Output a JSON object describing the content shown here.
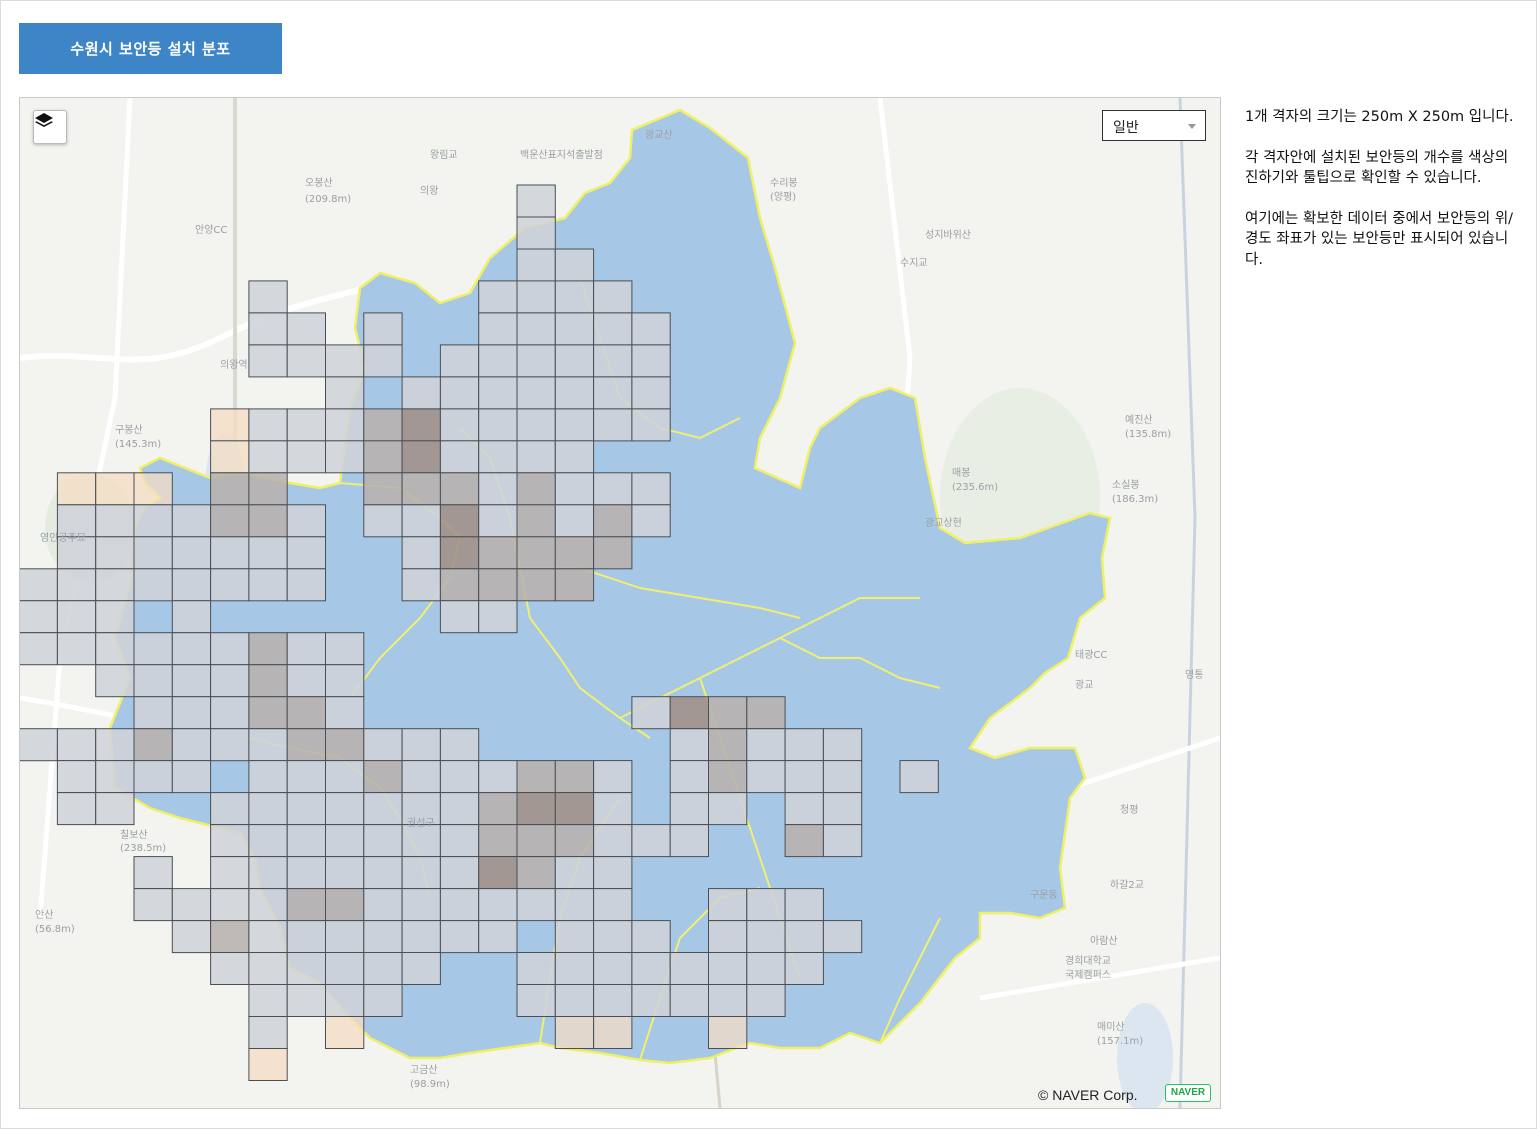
{
  "header": {
    "title": "수원시  보안등 설치 분포"
  },
  "map": {
    "map_type_selected": "일반",
    "copyright": "© NAVER Corp.",
    "logo_text": "NAVER",
    "grid_cell_size": "250m X 250m",
    "place_labels": [
      "오봉산",
      "(209.8m)",
      "안양CC",
      "의왕",
      "의왕역",
      "구봉산",
      "(145.3m)",
      "영안공주묘",
      "칠보산",
      "(238.5m)",
      "안산",
      "(56.8m)",
      "왕림교",
      "백운산표지석출발점",
      "광교산",
      "수리봉",
      "(양평)",
      "성지바위산",
      "수지교",
      "예진산",
      "(135.8m)",
      "소실봉",
      "(186.3m)",
      "매봉",
      "(235.6m)",
      "광교상현",
      "태광CC",
      "광교",
      "권선구",
      "구운동",
      "경희대학교",
      "국제캠퍼스",
      "하갈2교",
      "아람산",
      "매미산",
      "(157.1m)",
      "고금산",
      "(98.9m)",
      "청평",
      "영통"
    ],
    "colors": {
      "region_fill": "#a7c7e7",
      "boundary": "#f0f064",
      "cell_light": "#cfd3d8",
      "cell_mid": "#b8b2ae",
      "cell_dark": "#a39187",
      "cell_orange": "#f5dcc3"
    }
  },
  "info": {
    "p1": "1개 격자의 크기는 250m X 250m 입니다.",
    "p2": "각 격자안에 설치된 보안등의 개수를 색상의 진하기와 툴팁으로 확인할 수 있습니다.",
    "p3": "여기에는 확보한 데이터 중에서 보안등의  위/경도 좌표가 있는 보안등만 표시되어 있습니다."
  }
}
